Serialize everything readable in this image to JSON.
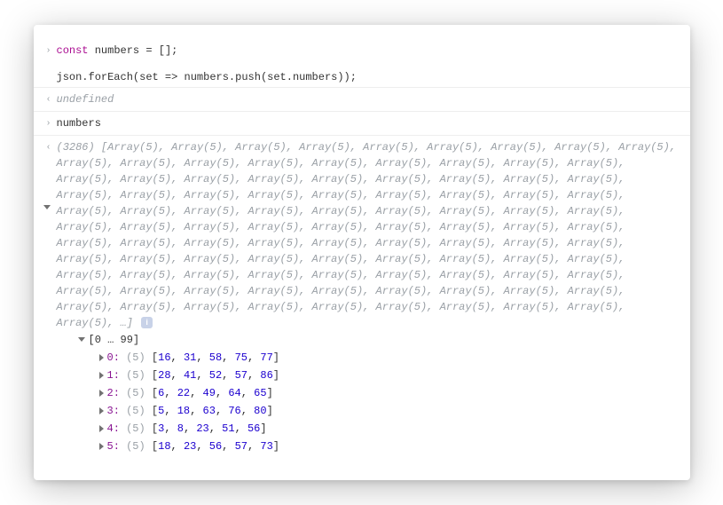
{
  "input1": {
    "kw": "const",
    "ident": "numbers",
    "eq": "=",
    "rest": "[];"
  },
  "input2": "json.forEach(set => numbers.push(set.numbers));",
  "undefined_label": "undefined",
  "expr_eval": "numbers",
  "preview": {
    "count": "(3286)",
    "body": " [Array(5), Array(5), Array(5), Array(5), Array(5), Array(5), Array(5), Array(5), Array(5), Array(5), Array(5), Array(5), Array(5), Array(5), Array(5), Array(5), Array(5), Array(5), Array(5), Array(5), Array(5), Array(5), Array(5), Array(5), Array(5), Array(5), Array(5), Array(5), Array(5), Array(5), Array(5), Array(5), Array(5), Array(5), Array(5), Array(5), Array(5), Array(5), Array(5), Array(5), Array(5), Array(5), Array(5), Array(5), Array(5), Array(5), Array(5), Array(5), Array(5), Array(5), Array(5), Array(5), Array(5), Array(5), Array(5), Array(5), Array(5), Array(5), Array(5), Array(5), Array(5), Array(5), Array(5), Array(5), Array(5), Array(5), Array(5), Array(5), Array(5), Array(5), Array(5), Array(5), Array(5), Array(5), Array(5), Array(5), Array(5), Array(5), Array(5), Array(5), Array(5), Array(5), Array(5), Array(5), Array(5), Array(5), Array(5), Array(5), Array(5), Array(5), Array(5), Array(5), Array(5), Array(5), Array(5), Array(5), Array(5), Array(5), Array(5), Array(5), …] ",
    "info": "i"
  },
  "range_label": "[0 … 99]",
  "rows": [
    {
      "key": "0:",
      "len": "(5)",
      "values": [
        16,
        31,
        58,
        75,
        77
      ]
    },
    {
      "key": "1:",
      "len": "(5)",
      "values": [
        28,
        41,
        52,
        57,
        86
      ]
    },
    {
      "key": "2:",
      "len": "(5)",
      "values": [
        6,
        22,
        49,
        64,
        65
      ]
    },
    {
      "key": "3:",
      "len": "(5)",
      "values": [
        5,
        18,
        63,
        76,
        80
      ]
    },
    {
      "key": "4:",
      "len": "(5)",
      "values": [
        3,
        8,
        23,
        51,
        56
      ]
    },
    {
      "key": "5:",
      "len": "(5)",
      "values": [
        18,
        23,
        56,
        57,
        73
      ]
    }
  ],
  "glyphs": {
    "prompt": "›",
    "result": "‹",
    "result_expand": "‹"
  }
}
